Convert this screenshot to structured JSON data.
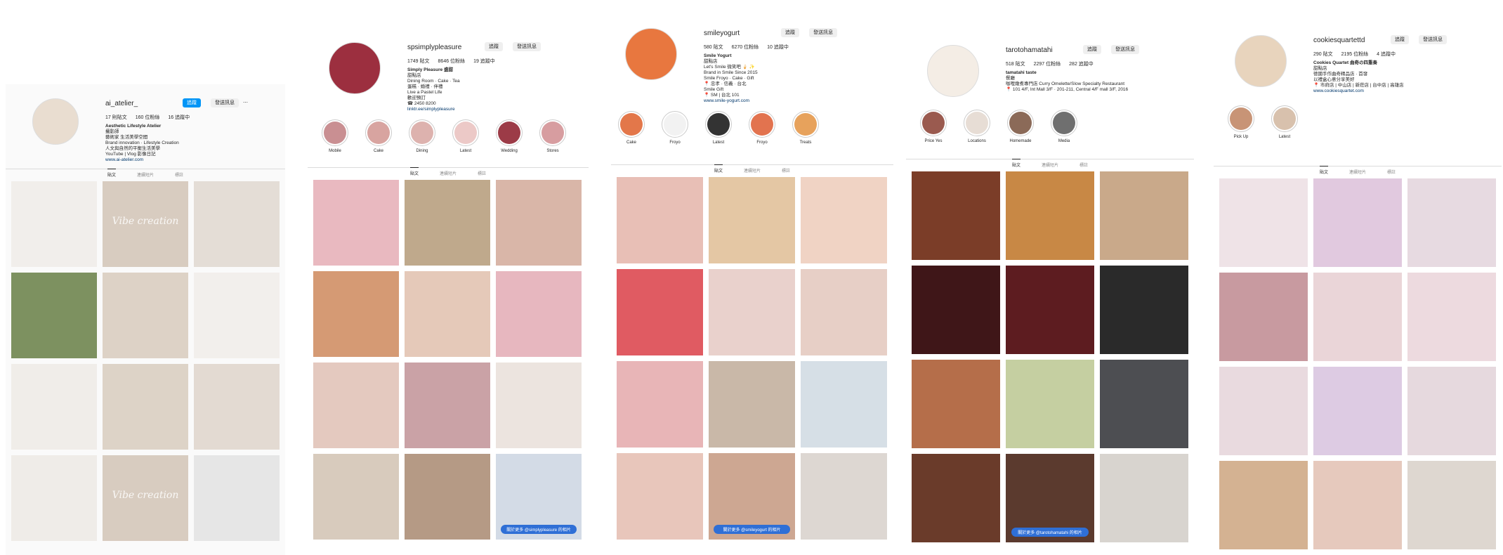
{
  "profiles": [
    {
      "username": "ai_atelier_",
      "buttons": [
        "追蹤",
        "發送訊息"
      ],
      "more": "⋯",
      "stats": [
        "17 則貼文",
        "160 位粉絲",
        "16 追蹤中"
      ],
      "bio_name": "Aesthetic Lifestyle Atelier",
      "bio_lines": "攝影師\n藝術家 生活美學空間\nBrand innovation · Lifestyle Creation\n人文與自然的平衡生活美學\nYouTube | Vlog 影像日記",
      "bio_link": "www.ai-atelier.com",
      "highlights": [],
      "tabs": [
        "貼文",
        "連續短片",
        "標註"
      ],
      "avatar_color": "#e9ddd0",
      "tiles": [
        {
          "bg": "#f1eeeb",
          "script": ""
        },
        {
          "bg": "#d8ccc0",
          "script": "Vibe creation"
        },
        {
          "bg": "#e4ddd6",
          "script": ""
        },
        {
          "bg": "#7d9160",
          "script": ""
        },
        {
          "bg": "#ddd2c6",
          "script": ""
        },
        {
          "bg": "#f2efec",
          "script": ""
        },
        {
          "bg": "#f0ede9",
          "script": ""
        },
        {
          "bg": "#ddd3c7",
          "script": ""
        },
        {
          "bg": "#e3dad2",
          "script": ""
        },
        {
          "bg": "#efece8",
          "script": ""
        },
        {
          "bg": "#d8ccc0",
          "script": "Vibe creation"
        },
        {
          "bg": "#e6e6e6",
          "script": ""
        }
      ]
    },
    {
      "username": "spsimplypleasure",
      "buttons": [
        "追蹤",
        "發送訊息"
      ],
      "stats": [
        "1749 貼文",
        "8646 位粉絲",
        "19 追蹤中"
      ],
      "bio_name": "Simply Pleasure 盛甜",
      "bio_lines": "甜點店\nDining Room · Cake · Tea\n蛋糕 · 婚禮 · 伴禮\nLive a Pastel Life\n歡迎預訂\n☎ 2450 8200",
      "bio_link": "linktr.ee/simplypleasure",
      "highlights": [
        {
          "label": "Mobile",
          "color": "#c98f92"
        },
        {
          "label": "Cake",
          "color": "#d8a4a0"
        },
        {
          "label": "Dining",
          "color": "#ddb2ae"
        },
        {
          "label": "Latest",
          "color": "#ecc9c7"
        },
        {
          "label": "Wedding",
          "color": "#9c3b47"
        },
        {
          "label": "Stores",
          "color": "#d79da0"
        }
      ],
      "tabs": [
        "貼文",
        "連續短片",
        "標註"
      ],
      "avatar_color": "#9c2f3f",
      "tiles": [
        {
          "bg": "#e9b9c0",
          "overlay": ""
        },
        {
          "bg": "#bfa98c",
          "overlay": ""
        },
        {
          "bg": "#d9b6a8",
          "overlay": ""
        },
        {
          "bg": "#d59a74",
          "overlay": ""
        },
        {
          "bg": "#e5c9b9",
          "overlay": ""
        },
        {
          "bg": "#e7b7bf",
          "overlay": ""
        },
        {
          "bg": "#e4c9bf",
          "overlay": ""
        },
        {
          "bg": "#caa2a6",
          "overlay": ""
        },
        {
          "bg": "#ece4df",
          "overlay": ""
        },
        {
          "bg": "#d8cbbd",
          "overlay": ""
        },
        {
          "bg": "#b59a85",
          "overlay": ""
        },
        {
          "bg": "#d3dbe6",
          "overlay": "關於更多 @simplypleasure 的相片"
        }
      ]
    },
    {
      "username": "smileyogurt",
      "buttons": [
        "追蹤",
        "發送訊息"
      ],
      "stats": [
        "580 貼文",
        "6270 位粉絲",
        "10 追蹤中"
      ],
      "bio_name": "Smile Yogurt",
      "bio_lines": "甜點店\nLet's Smile 微笑吧 🍦 ✨\nBrand in Smile Since 2015\nSmile Froyo · Cake · Gift\n📍 忠孝 · 信義 · 台北\nSmile Gift\n📍 SM | 台北 101",
      "bio_link": "www.smile-yogurt.com",
      "highlights": [
        {
          "label": "Cake",
          "color": "#e3774a"
        },
        {
          "label": "Froyo",
          "color": "#f2f2f2"
        },
        {
          "label": "Latest",
          "color": "#333333"
        },
        {
          "label": "Froyo",
          "color": "#e2734f"
        },
        {
          "label": "Treats",
          "color": "#e7a25c"
        }
      ],
      "tabs": [
        "貼文",
        "連續短片",
        "標註"
      ],
      "avatar_color": "#e8773f",
      "tiles": [
        {
          "bg": "#e8bfb6",
          "overlay": ""
        },
        {
          "bg": "#e4c7a4",
          "overlay": ""
        },
        {
          "bg": "#f0d3c4",
          "overlay": ""
        },
        {
          "bg": "#e05b62",
          "overlay": ""
        },
        {
          "bg": "#e9d1cc",
          "overlay": ""
        },
        {
          "bg": "#e7cfc6",
          "overlay": ""
        },
        {
          "bg": "#e8b5b7",
          "overlay": ""
        },
        {
          "bg": "#c9b8a8",
          "overlay": ""
        },
        {
          "bg": "#d6dfe6",
          "overlay": ""
        },
        {
          "bg": "#e8c6bb",
          "overlay": ""
        },
        {
          "bg": "#cda792",
          "overlay": "關於更多 @smileyogurt 的相片"
        },
        {
          "bg": "#ddd7d2",
          "overlay": ""
        }
      ]
    },
    {
      "username": "tarotohamatahi",
      "buttons": [
        "追蹤",
        "發送訊息"
      ],
      "stats": [
        "518 貼文",
        "2297 位粉絲",
        "282 追蹤中"
      ],
      "bio_name": "tamatahi taste",
      "bio_lines": "餐廳\n咖哩燉煮專門店 Curry Omelette/Slow Specialty Restaurant\n📍 101 4/F, Int Mall 3/F · 201-211, Central 4/F mall 3/F, 2016",
      "bio_link": "",
      "highlights": [
        {
          "label": "Price Yes",
          "color": "#9a5a4f"
        },
        {
          "label": "Locations",
          "color": "#e7ddd5"
        },
        {
          "label": "Homemade",
          "color": "#8b6a58"
        },
        {
          "label": "Media",
          "color": "#6f6f6f"
        }
      ],
      "tabs": [
        "貼文",
        "連續短片",
        "標註"
      ],
      "avatar_color": "#f4ede5",
      "tiles": [
        {
          "bg": "#7b3d28",
          "overlay": ""
        },
        {
          "bg": "#c88845",
          "overlay": ""
        },
        {
          "bg": "#c9a98a",
          "overlay": ""
        },
        {
          "bg": "#3f1618",
          "overlay": ""
        },
        {
          "bg": "#5d1c20",
          "overlay": ""
        },
        {
          "bg": "#2a2a2a",
          "overlay": ""
        },
        {
          "bg": "#b56e4a",
          "overlay": ""
        },
        {
          "bg": "#c5cfa1",
          "overlay": ""
        },
        {
          "bg": "#4d4e52",
          "overlay": ""
        },
        {
          "bg": "#6a3b2a",
          "overlay": ""
        },
        {
          "bg": "#5b3a2e",
          "overlay": "關於更多 @tarotohamatahi 的相片"
        },
        {
          "bg": "#d8d4cf",
          "overlay": ""
        }
      ]
    },
    {
      "username": "cookiesquartettd",
      "buttons": [
        "追蹤",
        "發送訊息"
      ],
      "stats": [
        "290 貼文",
        "2195 位粉絲",
        "4 追蹤中"
      ],
      "bio_name": "Cookies Quartet 曲奇の四重奏",
      "bio_lines": "甜點店\n德國手作曲奇精品店 · 首發\n以禮盒心意分享美好\n📍 市府店 | 中山店 | 新莊店 | 台中店 | 高雄店",
      "bio_link": "www.cookiesquartet.com",
      "highlights": [
        {
          "label": "Pick Up",
          "color": "#c89476"
        },
        {
          "label": "Latest",
          "color": "#d8c1ad"
        }
      ],
      "tabs": [
        "貼文",
        "連續短片",
        "標註"
      ],
      "avatar_color": "#e8d4bd",
      "tiles": [
        {
          "bg": "#efe3e7",
          "overlay": ""
        },
        {
          "bg": "#e1c9df",
          "overlay": ""
        },
        {
          "bg": "#e7dae1",
          "overlay": ""
        },
        {
          "bg": "#c89aa0",
          "overlay": ""
        },
        {
          "bg": "#ead5d8",
          "overlay": ""
        },
        {
          "bg": "#eddadf",
          "overlay": ""
        },
        {
          "bg": "#e9dadf",
          "overlay": ""
        },
        {
          "bg": "#ddcbe3",
          "overlay": ""
        },
        {
          "bg": "#e6d9de",
          "overlay": ""
        },
        {
          "bg": "#d4b292",
          "overlay": ""
        },
        {
          "bg": "#e6c9bd",
          "overlay": ""
        },
        {
          "bg": "#ded7d0",
          "overlay": ""
        }
      ]
    }
  ]
}
